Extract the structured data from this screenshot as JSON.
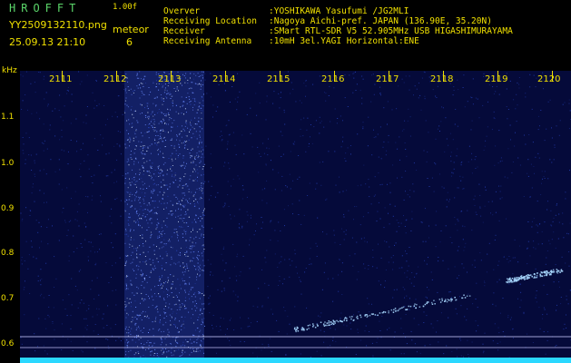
{
  "header": {
    "app_title": "HROFFT",
    "version": "1.00f",
    "filename": "YY2509132110.png",
    "datetime": "25.09.13 21:10",
    "meteor_label": "meteor",
    "meteor_count": "6"
  },
  "info": [
    {
      "label": "Overver",
      "value": ":YOSHIKAWA Yasufumi /JG2MLI"
    },
    {
      "label": "Receiving Location",
      "value": ":Nagoya Aichi-pref. JAPAN (136.90E, 35.20N)"
    },
    {
      "label": "Receiver",
      "value": ":SMart RTL-SDR V5 52.905MHz USB HIGASHIMURAYAMA"
    },
    {
      "label": "Receiving Antenna",
      "value": ":10mH 3el.YAGI Horizontal:ENE"
    }
  ],
  "axis": {
    "y_unit": "kHz",
    "y_ticks": [
      "1.1",
      "1.0",
      "0.9",
      "0.8",
      "0.7",
      "0.6"
    ],
    "x_ticks": [
      "2111",
      "2112",
      "2113",
      "2114",
      "2115",
      "2116",
      "2117",
      "2118",
      "2119",
      "2120"
    ]
  },
  "colors": {
    "background": "#000000",
    "spectrum_noise": "#1a2a9a",
    "signal": "#8fd0ff",
    "label_yellow": "#f0e000",
    "title_green": "#5bd66a",
    "baseline_cyan": "#2ad8ff"
  }
}
